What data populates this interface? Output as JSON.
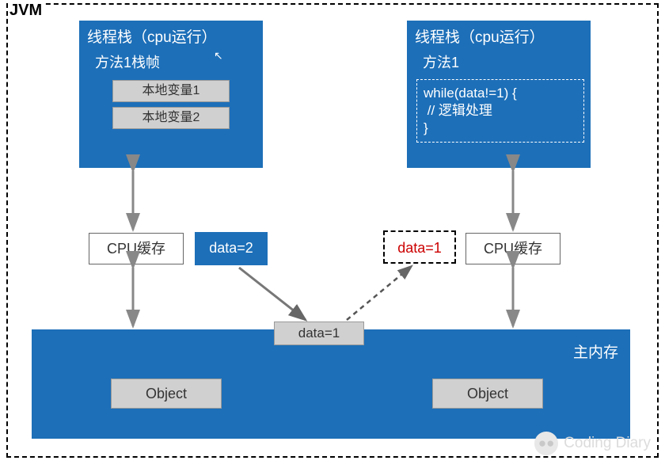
{
  "border_label": "JVM",
  "left_stack": {
    "title": "线程栈（cpu运行）",
    "frame_label": "方法1栈帧",
    "locals": [
      "本地变量1",
      "本地变量2"
    ]
  },
  "right_stack": {
    "title": "线程栈（cpu运行）",
    "frame_label": "方法1",
    "code": "while(data!=1) {\n // 逻辑处理\n}"
  },
  "cpu_cache_label": "CPU缓存",
  "data_left": "data=2",
  "data_right": "data=1",
  "memory_data": "data=1",
  "memory_label": "主内存",
  "object_label": "Object",
  "watermark": "Coding Diary"
}
